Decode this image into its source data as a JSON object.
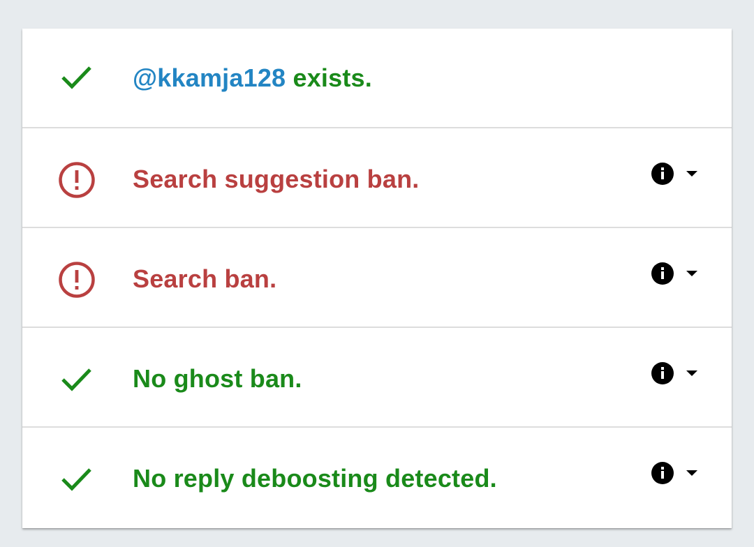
{
  "colors": {
    "background": "#e7ebee",
    "success": "#1a8a1a",
    "error": "#b94040",
    "handle": "#2385c3"
  },
  "results": [
    {
      "status": "ok",
      "icon": "check-icon",
      "handle": "@kkamja128",
      "text": " exists.",
      "has_info": false
    },
    {
      "status": "bad",
      "icon": "alert-circle-icon",
      "text": "Search suggestion ban.",
      "has_info": true
    },
    {
      "status": "bad",
      "icon": "alert-circle-icon",
      "text": "Search ban.",
      "has_info": true
    },
    {
      "status": "ok",
      "icon": "check-icon",
      "text": "No ghost ban.",
      "has_info": true
    },
    {
      "status": "ok",
      "icon": "check-icon",
      "text": "No reply deboosting detected.",
      "has_info": true
    }
  ]
}
